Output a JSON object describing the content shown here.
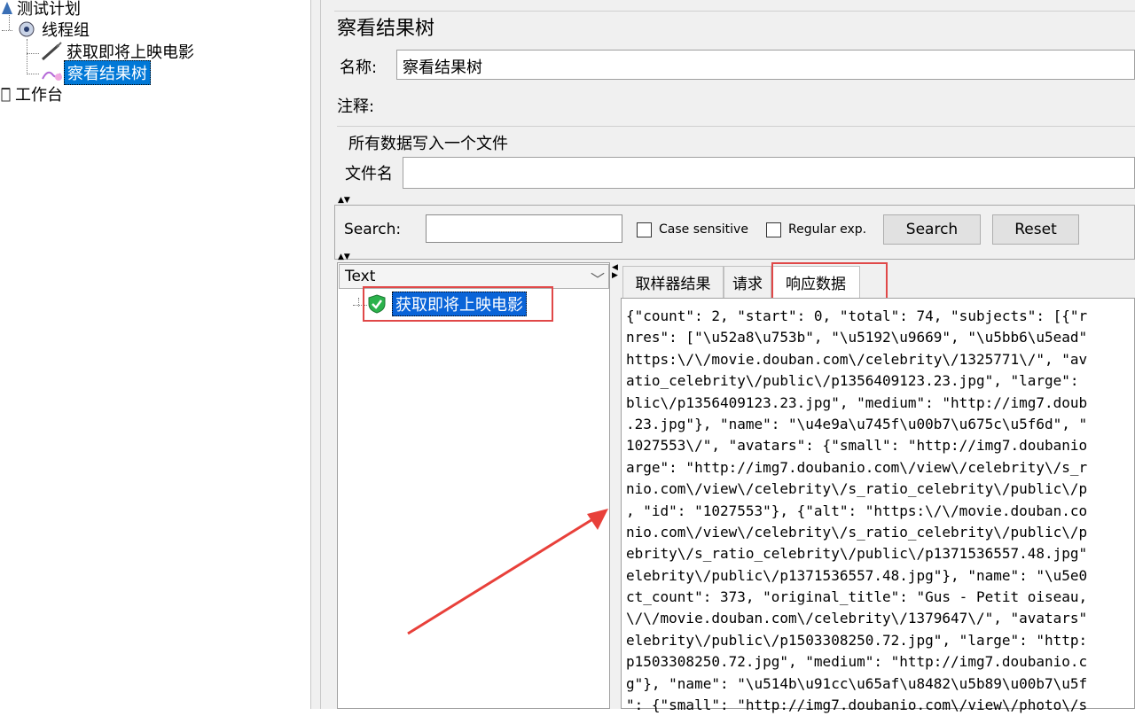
{
  "tree": {
    "items": [
      {
        "label": "测试计划",
        "selected": false
      },
      {
        "label": "线程组",
        "selected": false
      },
      {
        "label": "获取即将上映电影",
        "selected": false
      },
      {
        "label": "察看结果树",
        "selected": true
      },
      {
        "label": "工作台",
        "selected": false
      }
    ]
  },
  "panel": {
    "title": "察看结果树",
    "name_label": "名称:",
    "name_value": "察看结果树",
    "comment_label": "注释:",
    "comment_value": "",
    "file_group_title": "所有数据写入一个文件",
    "filename_label": "文件名",
    "filename_value": ""
  },
  "search": {
    "label": "Search:",
    "value": "",
    "case_sensitive_label": "Case sensitive",
    "regex_label": "Regular exp.",
    "search_button": "Search",
    "reset_button": "Reset"
  },
  "results": {
    "renderer": "Text",
    "samples": [
      {
        "label": "获取即将上映电影",
        "status": "success"
      }
    ],
    "tabs": [
      {
        "label": "取样器结果",
        "active": false
      },
      {
        "label": "请求",
        "active": false
      },
      {
        "label": "响应数据",
        "active": true
      }
    ],
    "response_lines": [
      "{\"count\": 2, \"start\": 0, \"total\": 74, \"subjects\": [{\"r",
      "nres\": [\"\\u52a8\\u753b\", \"\\u5192\\u9669\", \"\\u5bb6\\u5ead\"",
      "https:\\/\\/movie.douban.com\\/celebrity\\/1325771\\/\", \"av",
      "atio_celebrity\\/public\\/p1356409123.23.jpg\", \"large\":",
      "blic\\/p1356409123.23.jpg\", \"medium\": \"http://img7.doub",
      ".23.jpg\"}, \"name\": \"\\u4e9a\\u745f\\u00b7\\u675c\\u5f6d\", \"",
      "1027553\\/\", \"avatars\": {\"small\": \"http://img7.doubanio",
      "arge\": \"http://img7.doubanio.com\\/view\\/celebrity\\/s_r",
      "nio.com\\/view\\/celebrity\\/s_ratio_celebrity\\/public\\/p",
      ", \"id\": \"1027553\"}, {\"alt\": \"https:\\/\\/movie.douban.co",
      "nio.com\\/view\\/celebrity\\/s_ratio_celebrity\\/public\\/p",
      "ebrity\\/s_ratio_celebrity\\/public\\/p1371536557.48.jpg\"",
      "elebrity\\/public\\/p1371536557.48.jpg\"}, \"name\": \"\\u5e0",
      "ct_count\": 373, \"original_title\": \"Gus - Petit oiseau,",
      "\\/\\/movie.douban.com\\/celebrity\\/1379647\\/\", \"avatars\"",
      "elebrity\\/public\\/p1503308250.72.jpg\", \"large\": \"http:",
      "p1503308250.72.jpg\", \"medium\": \"http://img7.doubanio.c",
      "g\"}, \"name\": \"\\u514b\\u91cc\\u65af\\u8482\\u5b89\\u00b7\\u5f",
      "\": {\"small\": \"http://img7.doubanio.com\\/view\\/photo\\/s"
    ]
  },
  "colors": {
    "selection": "#0078d7",
    "annotation": "#e04848"
  }
}
